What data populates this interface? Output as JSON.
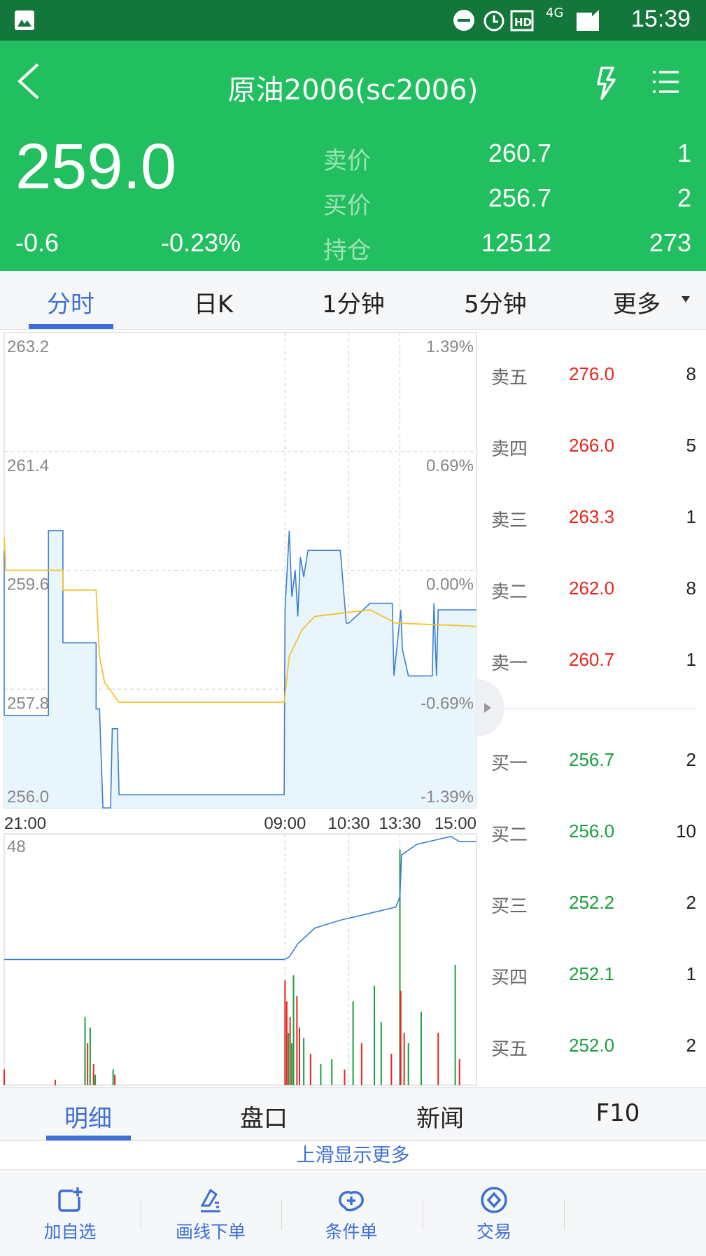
{
  "status_bar": {
    "time": "15:39",
    "network": "4G",
    "icons": [
      "gallery-icon",
      "dnd-icon",
      "alarm-icon",
      "hd-icon",
      "signal-icon",
      "battery-icon"
    ]
  },
  "header": {
    "title": "原油2006(sc2006)",
    "last_price": "259.0",
    "change": "-0.6",
    "change_pct": "-0.23%",
    "quotes": [
      {
        "label": "卖价",
        "value": "260.7",
        "qty": "1"
      },
      {
        "label": "买价",
        "value": "256.7",
        "qty": "2"
      },
      {
        "label": "持仓",
        "value": "12512",
        "qty": "273"
      }
    ]
  },
  "period_tabs": [
    {
      "label": "分时",
      "active": true
    },
    {
      "label": "日K"
    },
    {
      "label": "1分钟"
    },
    {
      "label": "5分钟"
    },
    {
      "label": "更多"
    }
  ],
  "order_book": {
    "asks": [
      {
        "label": "卖五",
        "price": "276.0",
        "qty": "8"
      },
      {
        "label": "卖四",
        "price": "266.0",
        "qty": "5"
      },
      {
        "label": "卖三",
        "price": "263.3",
        "qty": "1"
      },
      {
        "label": "卖二",
        "price": "262.0",
        "qty": "8"
      },
      {
        "label": "卖一",
        "price": "260.7",
        "qty": "1"
      }
    ],
    "bids": [
      {
        "label": "买一",
        "price": "256.7",
        "qty": "2"
      },
      {
        "label": "买二",
        "price": "256.0",
        "qty": "10"
      },
      {
        "label": "买三",
        "price": "252.2",
        "qty": "2"
      },
      {
        "label": "买四",
        "price": "252.1",
        "qty": "1"
      },
      {
        "label": "买五",
        "price": "252.0",
        "qty": "2"
      }
    ]
  },
  "colors": {
    "up": "#e8251f",
    "down": "#1a9f3f",
    "price_line": "#3b7fd1",
    "avg_line": "#f2c32c",
    "accent": "#3d6fd6",
    "header": "#21bf5f"
  },
  "chart_data": [
    {
      "type": "line",
      "ylim": [
        256.0,
        263.2
      ],
      "y_ticks": [
        "263.2",
        "261.4",
        "259.6",
        "257.8",
        "256.0"
      ],
      "pct_ticks": [
        "1.39%",
        "0.69%",
        "0.00%",
        "-0.69%",
        "-1.39%"
      ],
      "x_ticks": [
        "21:00",
        "09:00",
        "10:30",
        "13:30",
        "15:00"
      ],
      "grid": true,
      "price": [
        [
          "21:00",
          259.9
        ],
        [
          "21:00",
          257.4
        ],
        [
          "21:52",
          257.4
        ],
        [
          "21:52",
          260.2
        ],
        [
          "22:09",
          260.2
        ],
        [
          "22:09",
          258.5
        ],
        [
          "22:48",
          258.5
        ],
        [
          "22:48",
          257.5
        ],
        [
          "22:52",
          257.5
        ],
        [
          "22:56",
          256.0
        ],
        [
          "23:05",
          256.0
        ],
        [
          "23:07",
          257.2
        ],
        [
          "23:13",
          257.2
        ],
        [
          "23:15",
          256.2
        ],
        [
          "02:29",
          256.2
        ],
        [
          "09:00",
          259.0
        ],
        [
          "09:05",
          260.2
        ],
        [
          "09:08",
          259.2
        ],
        [
          "09:12",
          259.6
        ],
        [
          "09:15",
          258.9
        ],
        [
          "09:18",
          259.8
        ],
        [
          "09:22",
          259.5
        ],
        [
          "09:27",
          259.9
        ],
        [
          "10:05",
          259.9
        ],
        [
          "10:12",
          258.8
        ],
        [
          "10:15",
          258.8
        ],
        [
          "10:55",
          259.1
        ],
        [
          "11:21",
          259.1
        ],
        [
          "11:23",
          258.0
        ],
        [
          "13:31",
          259.0
        ],
        [
          "13:33",
          258.4
        ],
        [
          "13:40",
          258.0
        ],
        [
          "14:08",
          258.0
        ],
        [
          "14:10",
          259.1
        ],
        [
          "14:13",
          258.0
        ],
        [
          "14:15",
          259.0
        ],
        [
          "15:00",
          259.0
        ]
      ],
      "average": [
        [
          "21:00",
          260.1
        ],
        [
          "21:02",
          259.6
        ],
        [
          "22:09",
          259.6
        ],
        [
          "22:09",
          259.3
        ],
        [
          "22:48",
          259.3
        ],
        [
          "22:52",
          258.3
        ],
        [
          "22:58",
          257.9
        ],
        [
          "23:15",
          257.6
        ],
        [
          "02:29",
          257.6
        ],
        [
          "09:05",
          258.3
        ],
        [
          "09:20",
          258.7
        ],
        [
          "09:35",
          258.9
        ],
        [
          "10:55",
          259.0
        ],
        [
          "11:25",
          258.8
        ],
        [
          "15:00",
          258.75
        ]
      ]
    },
    {
      "type": "bar",
      "ylim": [
        0,
        48
      ],
      "y_ticks": [
        "48"
      ],
      "volume": [
        [
          "21:00",
          3,
          "up"
        ],
        [
          "22:00",
          1,
          "up"
        ],
        [
          "22:35",
          13,
          "down"
        ],
        [
          "22:38",
          8,
          "up"
        ],
        [
          "22:41",
          11,
          "down"
        ],
        [
          "22:45",
          4,
          "up"
        ],
        [
          "22:47",
          2,
          "down"
        ],
        [
          "23:08",
          3,
          "down"
        ],
        [
          "23:10",
          2,
          "up"
        ],
        [
          "09:00",
          20,
          "up"
        ],
        [
          "09:02",
          16,
          "up"
        ],
        [
          "09:04",
          10,
          "down"
        ],
        [
          "09:06",
          13,
          "up"
        ],
        [
          "09:08",
          8,
          "down"
        ],
        [
          "09:10",
          21,
          "down"
        ],
        [
          "09:14",
          17,
          "up"
        ],
        [
          "09:17",
          11,
          "up"
        ],
        [
          "09:22",
          9,
          "down"
        ],
        [
          "09:30",
          6,
          "up"
        ],
        [
          "09:42",
          4,
          "down"
        ],
        [
          "09:55",
          5,
          "down"
        ],
        [
          "10:10",
          3,
          "up"
        ],
        [
          "10:35",
          16,
          "down"
        ],
        [
          "10:45",
          8,
          "up"
        ],
        [
          "11:00",
          19,
          "down"
        ],
        [
          "11:08",
          12,
          "down"
        ],
        [
          "11:20",
          6,
          "up"
        ],
        [
          "13:30",
          45,
          "down"
        ],
        [
          "13:31",
          18,
          "up"
        ],
        [
          "13:35",
          10,
          "up"
        ],
        [
          "13:40",
          8,
          "down"
        ],
        [
          "13:55",
          14,
          "down"
        ],
        [
          "14:15",
          10,
          "up"
        ],
        [
          "14:35",
          23,
          "down"
        ],
        [
          "14:40",
          5,
          "up"
        ]
      ],
      "open_interest": [
        [
          "21:00",
          24
        ],
        [
          "02:29",
          24
        ],
        [
          "09:05",
          24.5
        ],
        [
          "09:15",
          27
        ],
        [
          "09:35",
          30
        ],
        [
          "10:05",
          31.5
        ],
        [
          "11:25",
          34
        ],
        [
          "13:30",
          36
        ],
        [
          "13:32",
          44
        ],
        [
          "13:50",
          46
        ],
        [
          "14:30",
          47.5
        ],
        [
          "14:40",
          46.5
        ],
        [
          "15:00",
          46.5
        ]
      ]
    }
  ],
  "bottom_tabs": [
    {
      "label": "明细",
      "active": true
    },
    {
      "label": "盘口"
    },
    {
      "label": "新闻"
    },
    {
      "label": "F10"
    }
  ],
  "more_hint": "上滑显示更多",
  "toolbar": [
    {
      "label": "加自选",
      "icon": "add-watchlist-icon"
    },
    {
      "label": "画线下单",
      "icon": "draw-order-icon"
    },
    {
      "label": "条件单",
      "icon": "condition-order-icon"
    },
    {
      "label": "交易",
      "icon": "trade-icon"
    }
  ]
}
